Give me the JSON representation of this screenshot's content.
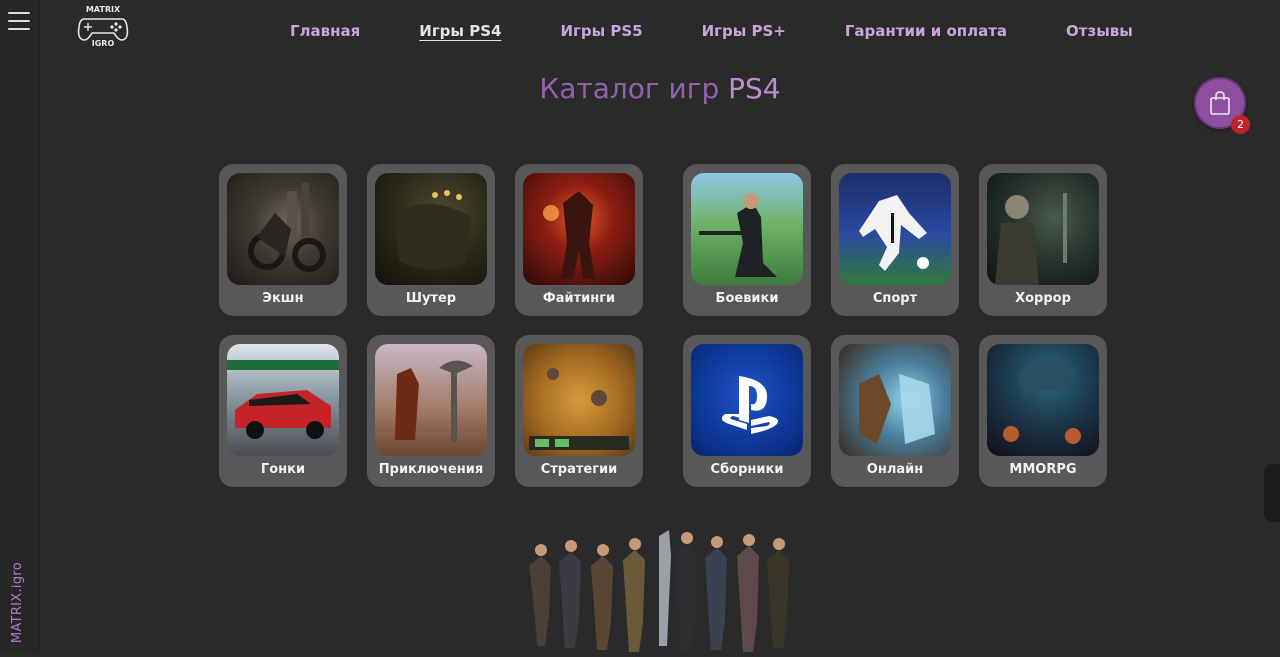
{
  "rail": {
    "brand": "MATRIX.igro"
  },
  "logo": {
    "line1": "MATRIX",
    "line2": "IGRO"
  },
  "nav": [
    {
      "label": "Главная",
      "active": false
    },
    {
      "label": "Игры PS4",
      "active": true
    },
    {
      "label": "Игры PS5",
      "active": false
    },
    {
      "label": "Игры PS+",
      "active": false
    },
    {
      "label": "Гарантии и оплата",
      "active": false
    },
    {
      "label": "Отзывы",
      "active": false
    }
  ],
  "title": {
    "main": "Каталог игр",
    "accent": "PS4"
  },
  "cart": {
    "count": "2"
  },
  "categories": [
    {
      "label": "Экшн"
    },
    {
      "label": "Шутер"
    },
    {
      "label": "Файтинги"
    },
    {
      "label": "Боевики"
    },
    {
      "label": "Спорт"
    },
    {
      "label": "Хоррор"
    },
    {
      "label": "Гонки"
    },
    {
      "label": "Приключения"
    },
    {
      "label": "Стратегии"
    },
    {
      "label": "Сборники"
    },
    {
      "label": "Онлайн"
    },
    {
      "label": "MMORPG"
    }
  ]
}
